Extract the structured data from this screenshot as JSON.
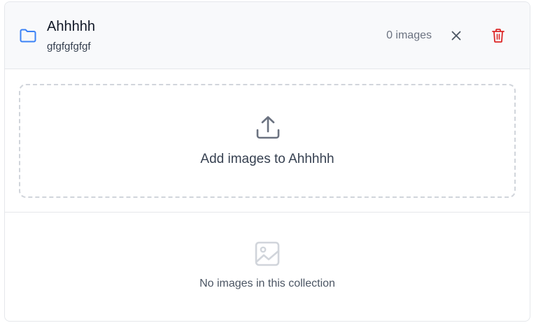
{
  "collection": {
    "title": "Ahhhhh",
    "description": "gfgfgfgfgf",
    "image_count": "0 images"
  },
  "upload": {
    "label": "Add images to Ahhhhh"
  },
  "empty_state": {
    "message": "No images in this collection"
  },
  "icons": {
    "folder": "folder-icon",
    "close": "close-icon",
    "delete": "trash-icon",
    "upload": "upload-icon",
    "empty": "image-icon"
  },
  "colors": {
    "folder_icon": "#3b82f6",
    "delete_icon": "#dc2626",
    "muted_icon": "#9ca3af"
  }
}
